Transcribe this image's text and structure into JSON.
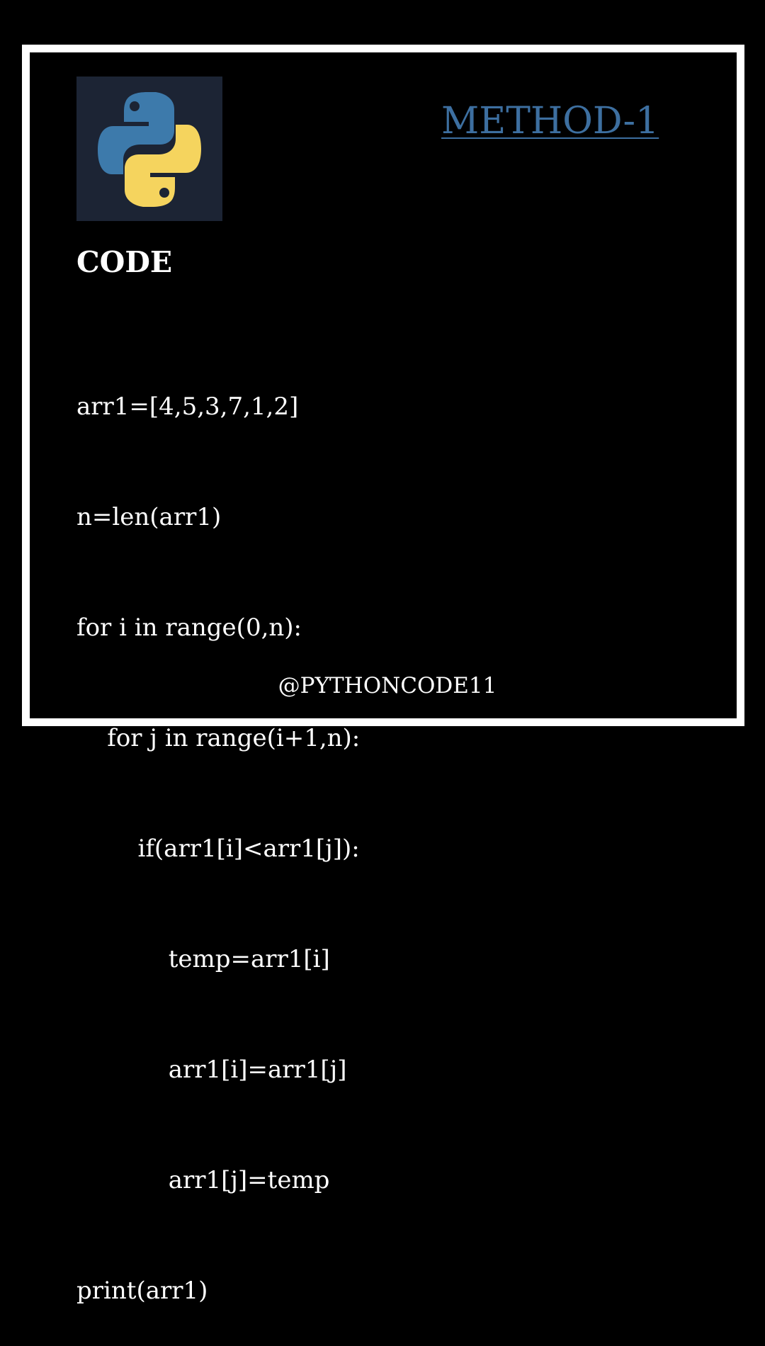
{
  "logo": {
    "icon": "python-logo-icon",
    "background_color": "#1c2434",
    "blue_color": "#3d7aab",
    "yellow_color": "#f5d45e"
  },
  "header": {
    "method_link": "METHOD-1",
    "link_color": "#3d6fa0"
  },
  "section": {
    "title": "CODE"
  },
  "code": {
    "lines": [
      "arr1=[4,5,3,7,1,2]",
      "n=len(arr1)",
      "for i in range(0,n):",
      "    for j in range(i+1,n):",
      "        if(arr1[i]<arr1[j]):",
      "            temp=arr1[i]",
      "            arr1[i]=arr1[j]",
      "            arr1[j]=temp",
      "print(arr1)"
    ]
  },
  "footer": {
    "handle": "@PYTHONCODE11"
  },
  "colors": {
    "background": "#000000",
    "frame_border": "#ffffff",
    "text": "#ffffff"
  }
}
